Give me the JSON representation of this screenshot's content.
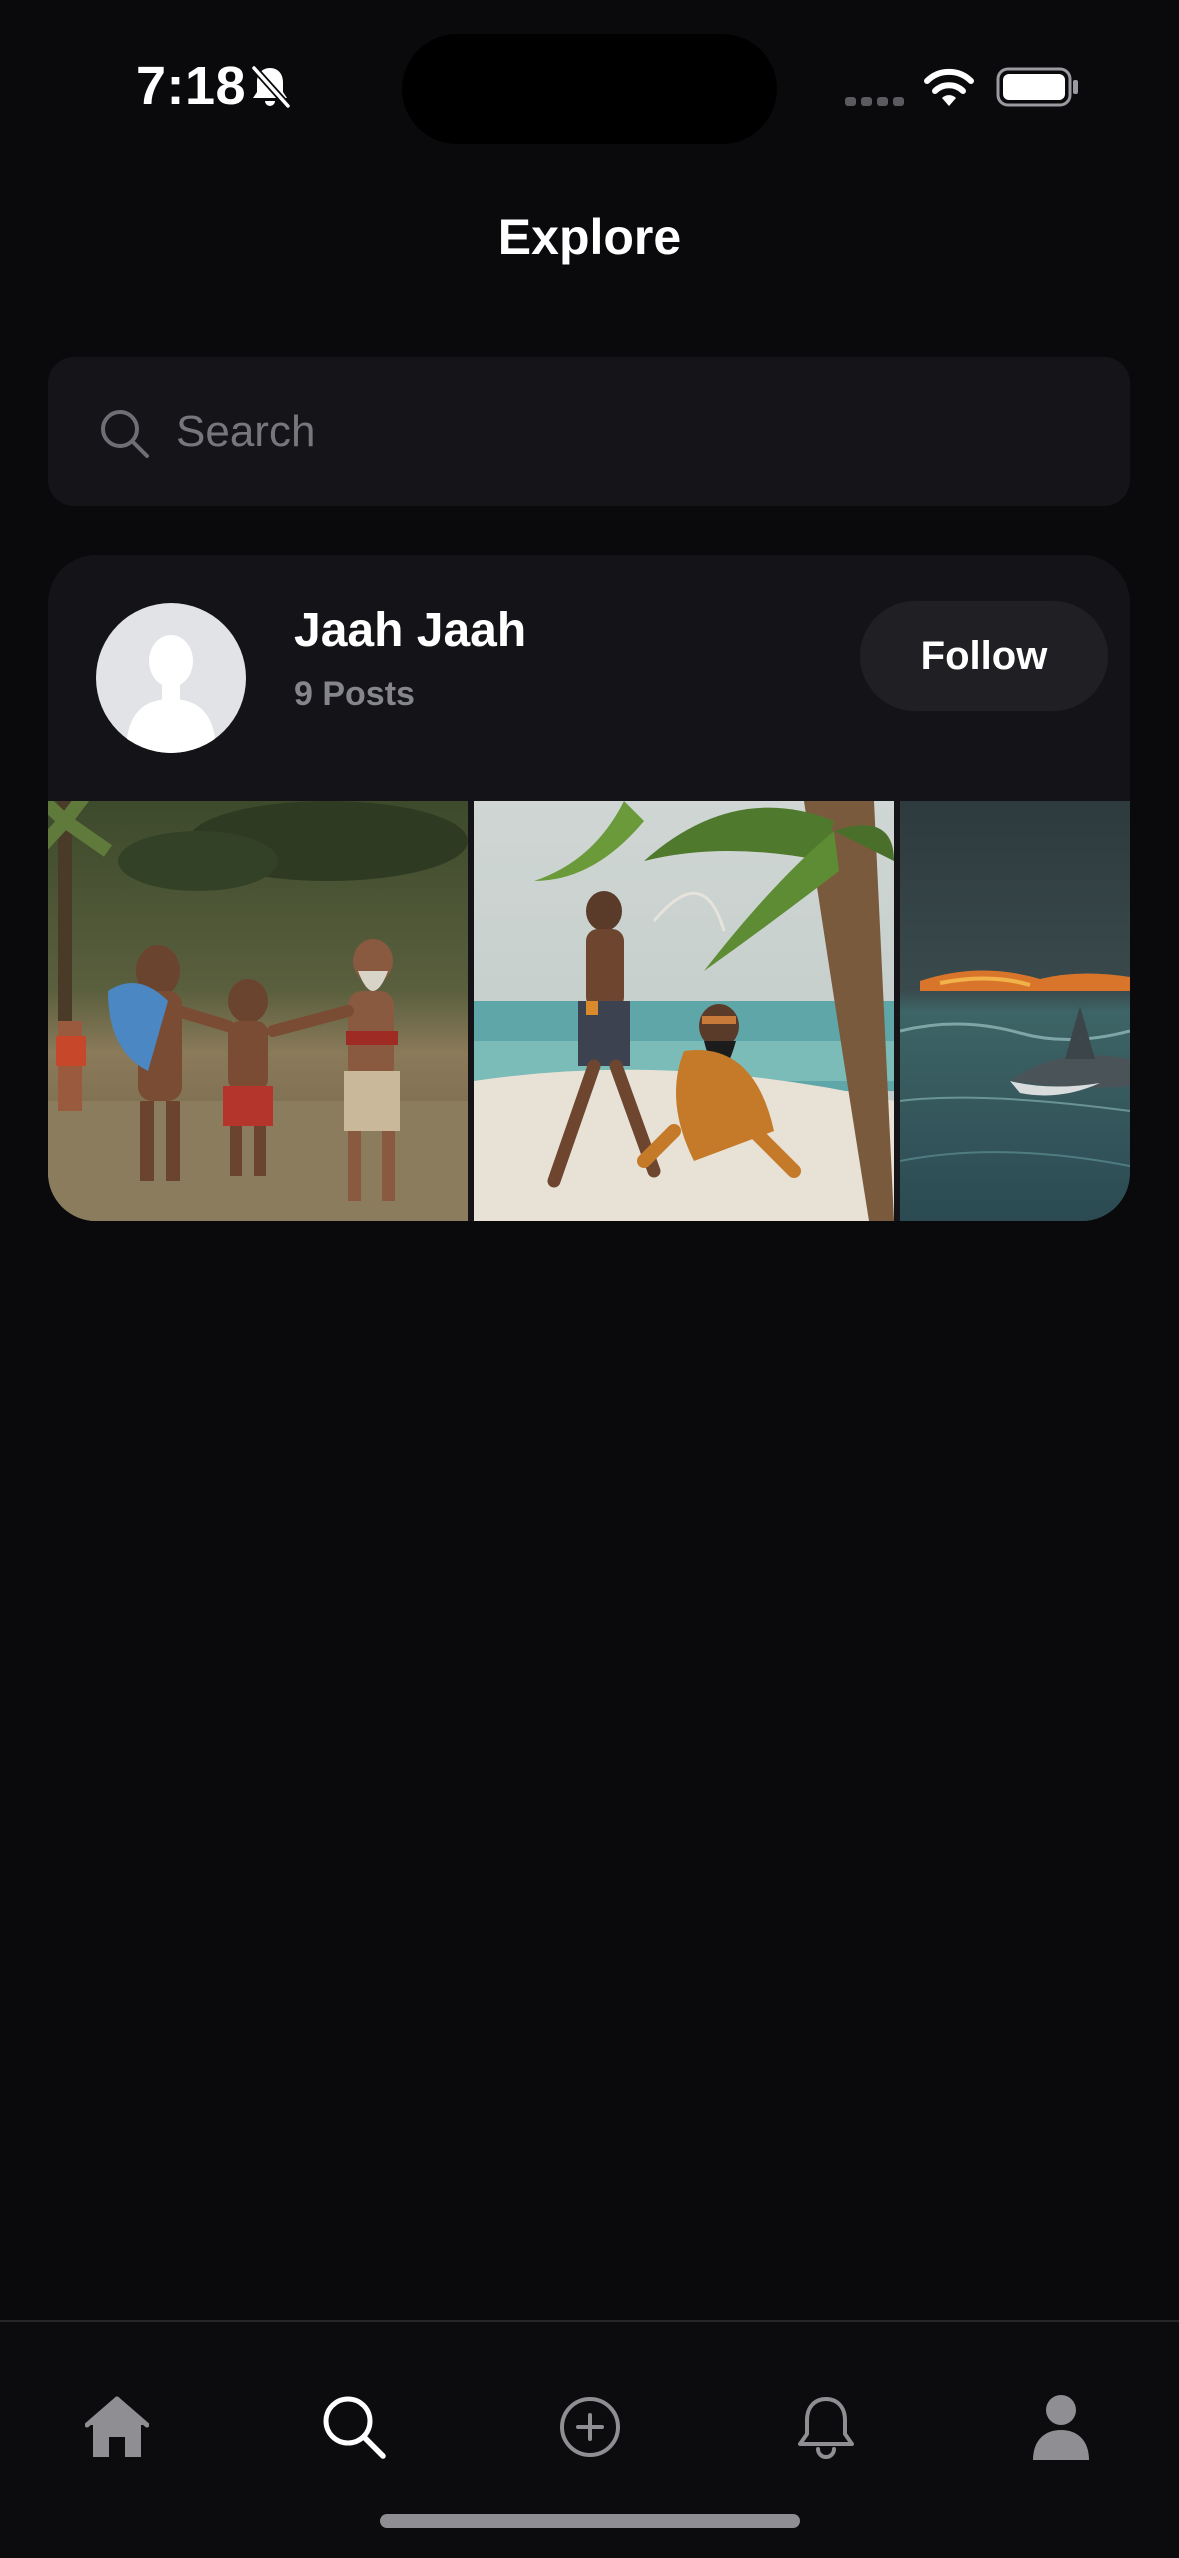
{
  "status_bar": {
    "time": "7:18",
    "icons": [
      "bell-slash-icon",
      "signal-icon",
      "wifi-icon",
      "battery-icon"
    ]
  },
  "header": {
    "title": "Explore"
  },
  "search": {
    "placeholder": "Search",
    "value": "",
    "icon": "search-icon"
  },
  "user_card": {
    "name": "Jaah Jaah",
    "posts_label": "9 Posts",
    "follow_label": "Follow",
    "avatar_icon": "default-avatar-icon",
    "posts": [
      {
        "alt": "Men wrestling among palm trees"
      },
      {
        "alt": "Two men on a beach under palm trees"
      },
      {
        "alt": "Shark leaping from the sea"
      }
    ]
  },
  "tab_bar": {
    "items": [
      {
        "name": "home",
        "icon": "home-icon",
        "active": false
      },
      {
        "name": "search",
        "icon": "search-icon",
        "active": true
      },
      {
        "name": "create",
        "icon": "plus-circle-icon",
        "active": false
      },
      {
        "name": "notifications",
        "icon": "bell-icon",
        "active": false
      },
      {
        "name": "profile",
        "icon": "person-icon",
        "active": false
      }
    ]
  },
  "colors": {
    "background": "#0a0a0c",
    "surface": "#141418",
    "search_surface": "#151519",
    "muted_text": "#85858c",
    "inactive_icon": "#8e8e93",
    "active_icon": "#ffffff"
  }
}
